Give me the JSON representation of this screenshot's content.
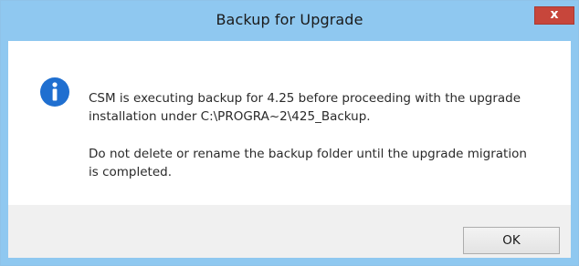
{
  "window": {
    "title": "Backup for Upgrade",
    "close_label": "x"
  },
  "message": {
    "line1": " CSM is executing backup for 4.25 before proceeding with the upgrade\ninstallation under C:\\PROGRA~2\\425_Backup.",
    "line2": " Do not delete or rename the backup folder until the upgrade migration\nis completed."
  },
  "icon": "info-icon",
  "buttons": {
    "ok_label": "OK"
  },
  "colors": {
    "titlebar": "#8fc8f0",
    "close_button": "#c7463b",
    "info_icon": "#1f6fd0",
    "footer": "#f0f0f0"
  }
}
